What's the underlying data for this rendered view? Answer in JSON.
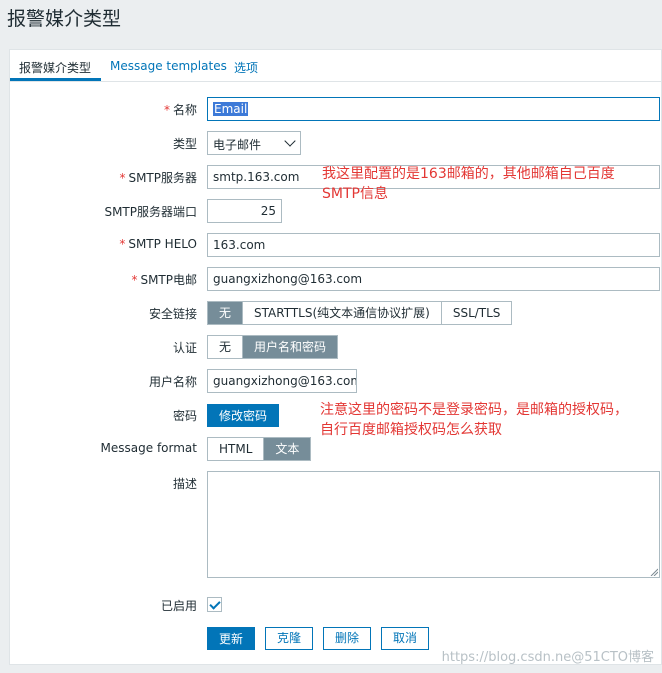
{
  "page": {
    "title": "报警媒介类型"
  },
  "tabs": [
    {
      "label": "报警媒介类型",
      "active": true
    },
    {
      "label": "Message templates",
      "active": false
    },
    {
      "label": "选项",
      "active": false
    }
  ],
  "form": {
    "name": {
      "label": "名称",
      "required": true,
      "value": "Email"
    },
    "type": {
      "label": "类型",
      "value": "电子邮件"
    },
    "smtp_server": {
      "label": "SMTP服务器",
      "required": true,
      "value": "smtp.163.com"
    },
    "smtp_port": {
      "label": "SMTP服务器端口",
      "value": "25"
    },
    "smtp_helo": {
      "label": "SMTP HELO",
      "required": true,
      "value": "163.com"
    },
    "smtp_email": {
      "label": "SMTP电邮",
      "required": true,
      "value": "guangxizhong@163.com"
    },
    "security": {
      "label": "安全链接",
      "options": [
        "无",
        "STARTTLS(纯文本通信协议扩展)",
        "SSL/TLS"
      ],
      "selected": 0
    },
    "auth": {
      "label": "认证",
      "options": [
        "无",
        "用户名和密码"
      ],
      "selected": 1
    },
    "username": {
      "label": "用户名称",
      "value": "guangxizhong@163.com"
    },
    "password": {
      "label": "密码",
      "button": "修改密码"
    },
    "message_format": {
      "label": "Message format",
      "options": [
        "HTML",
        "文本"
      ],
      "selected": 1
    },
    "description": {
      "label": "描述",
      "value": ""
    },
    "enabled": {
      "label": "已启用",
      "checked": true
    }
  },
  "actions": {
    "update": "更新",
    "clone": "克隆",
    "delete": "删除",
    "cancel": "取消"
  },
  "annotations": {
    "smtp_note": [
      "我这里配置的是163邮箱的，其他邮箱自己百度",
      "SMTP信息"
    ],
    "password_note": [
      "注意这里的密码不是登录密码，是邮箱的授权码，",
      "自行百度邮箱授权码怎么获取"
    ]
  },
  "watermark": "https://blog.csdn.ne@51CTO博客",
  "colors": {
    "accent": "#0275b8",
    "required": "#e33734",
    "segment_on": "#768d99"
  }
}
